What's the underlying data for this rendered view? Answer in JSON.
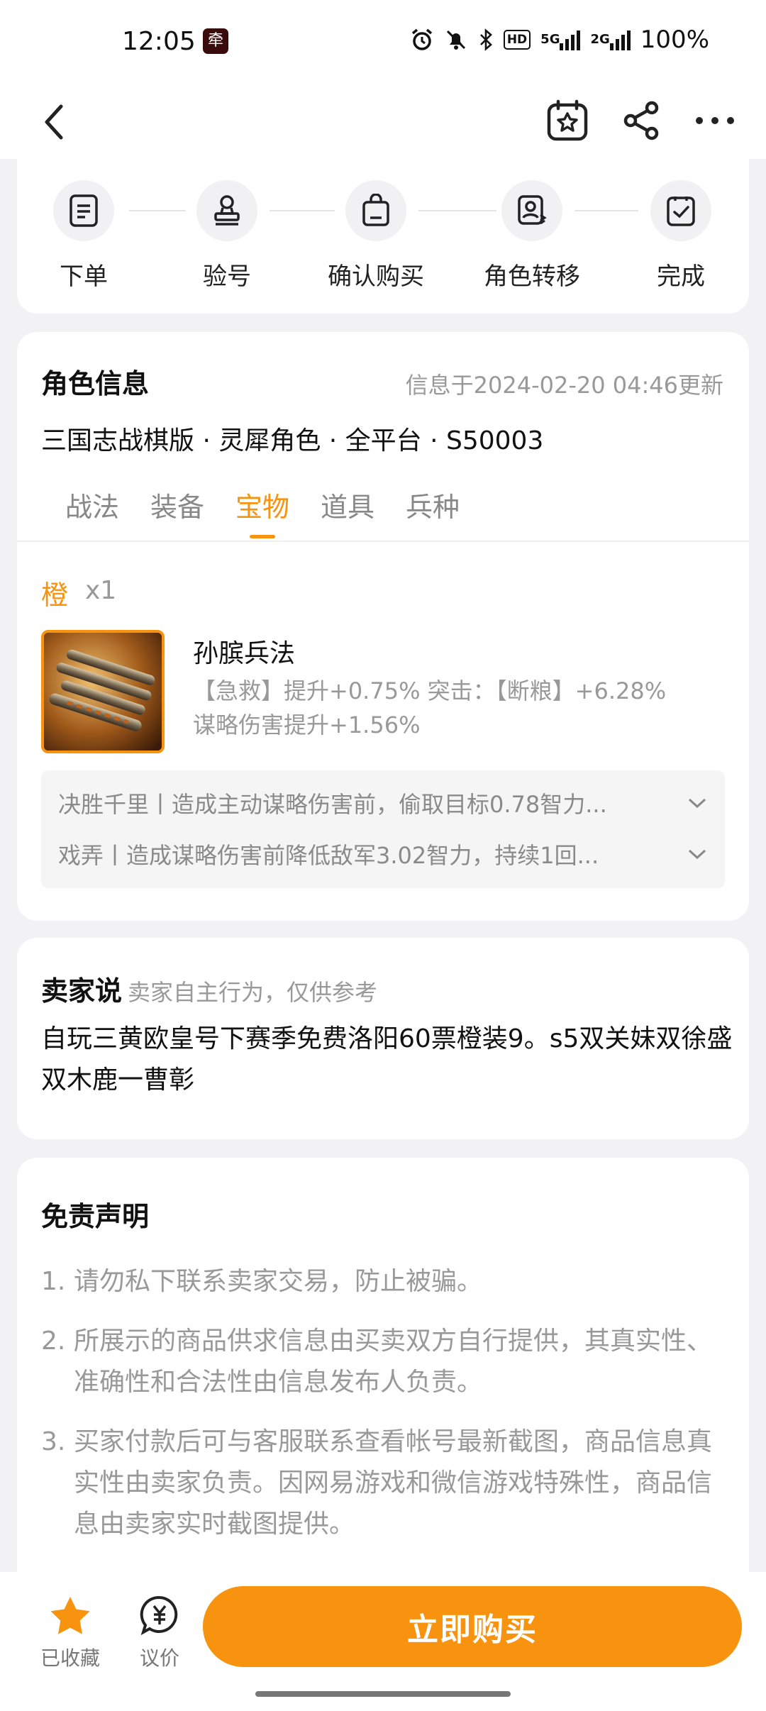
{
  "status_bar": {
    "time": "12:05",
    "app_icon_char": "牵",
    "network": "5G",
    "network2": "2G",
    "battery": "100%",
    "hd_badge": "HD"
  },
  "steps": [
    "下单",
    "验号",
    "确认购买",
    "角色转移",
    "完成"
  ],
  "role": {
    "title": "角色信息",
    "updated": "信息于2024-02-20 04:46更新",
    "subtitle": "三国志战棋版 · 灵犀角色 · 全平台 · S50003",
    "tabs": [
      "战法",
      "装备",
      "宝物",
      "道具",
      "兵种"
    ],
    "active_tab": "宝物"
  },
  "treasure": {
    "rarity": "橙",
    "count": "x1",
    "name": "孙膑兵法",
    "stats_line1": "【急救】提升+0.75% 突击：【断粮】+6.28%",
    "stats_line2": "谋略伤害提升+1.56%",
    "skills": [
      "决胜千里丨造成主动谋略伤害前，偷取目标0.78智力...",
      "戏弄丨造成谋略伤害前降低敌军3.02智力，持续1回..."
    ]
  },
  "seller": {
    "title": "卖家说",
    "note": "卖家自主行为，仅供参考",
    "text": "自玩三黄欧皇号下赛季免费洛阳60票橙装9。s5双关妹双徐盛双木鹿一曹彰"
  },
  "disclaimer": {
    "title": "免责声明",
    "items": [
      {
        "num": "1.",
        "text": "请勿私下联系卖家交易，防止被骗。"
      },
      {
        "num": "2.",
        "text": "所展示的商品供求信息由买卖双方自行提供，其真实性、准确性和合法性由信息发布人负责。"
      },
      {
        "num": "3.",
        "text": "买家付款后可与客服联系查看帐号最新截图，商品信息真实性由卖家负责。因网易游戏和微信游戏特殊性，商品信息由卖家实时截图提供。"
      }
    ]
  },
  "bottom": {
    "fav_label": "已收藏",
    "bargain_label": "议价",
    "buy_label": "立即购买"
  },
  "colors": {
    "accent": "#f7930e",
    "bg": "#f2f2f4"
  }
}
